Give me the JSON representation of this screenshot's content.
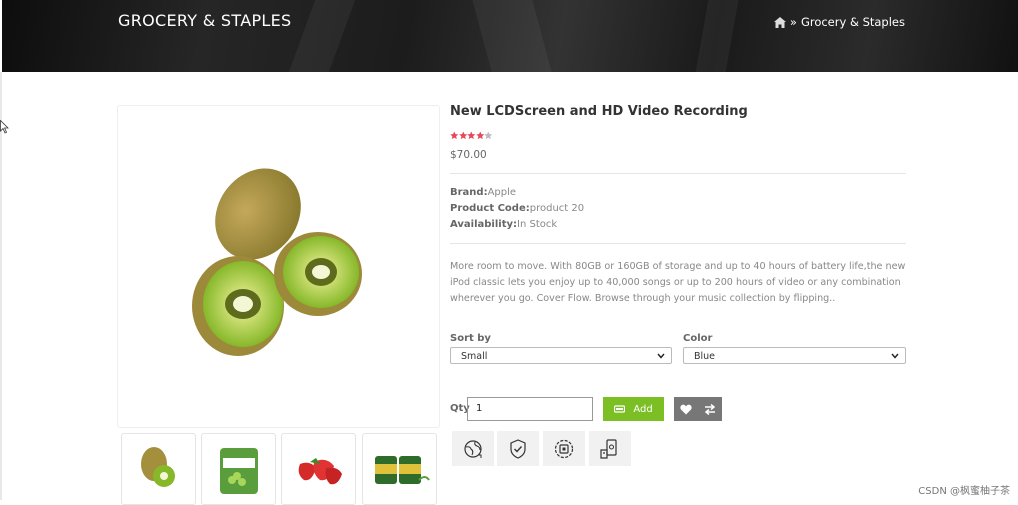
{
  "banner": {
    "title": "GROCERY & STAPLES",
    "breadcrumb": "Grocery & Staples"
  },
  "product": {
    "title": "New LCDScreen and HD Video Recording",
    "rating": 4,
    "rating_max": 5,
    "price": "$70.00",
    "brand_label": "Brand:",
    "brand": "Apple",
    "code_label": "Product Code:",
    "code": "product 20",
    "availability_label": "Availability:",
    "availability": "In Stock",
    "description": "More room to move. With 80GB or 160GB of storage and up to 40 hours of battery life,the new iPod classic lets you enjoy up to 40,000 songs or up to 200 hours of video or any combination wherever you go. Cover Flow. Browse through your music collection by flipping.."
  },
  "options": {
    "sort_label": "Sort by",
    "sort_value": "Small",
    "color_label": "Color",
    "color_value": "Blue"
  },
  "cart": {
    "qty_label": "Qty",
    "qty_value": "1",
    "add_label": "Add"
  },
  "colors": {
    "accent": "#7bbf25",
    "star": "#e8475b",
    "star_off": "#bbbbbb",
    "icon_button": "#777777"
  },
  "icons": [
    "home-icon",
    "cart-icon",
    "heart-icon",
    "compare-icon",
    "globe-icon",
    "shield-icon",
    "chip-icon",
    "money-icon"
  ],
  "watermark": "CSDN @枫蜜柚子茶"
}
